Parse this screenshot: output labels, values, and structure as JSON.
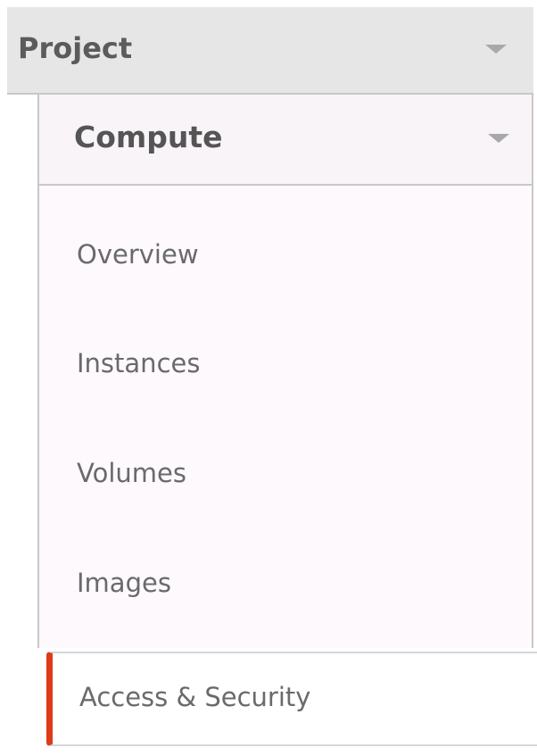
{
  "sidebar": {
    "project": {
      "label": "Project",
      "icon": "chevron-down-icon"
    },
    "compute": {
      "label": "Compute",
      "icon": "chevron-down-icon"
    },
    "items": [
      {
        "label": "Overview"
      },
      {
        "label": "Instances"
      },
      {
        "label": "Volumes"
      },
      {
        "label": "Images"
      },
      {
        "label": "Access & Security",
        "active": true
      }
    ],
    "colors": {
      "active_accent": "#dd3b17",
      "header_bg": "#e6e6e6",
      "text": "#6a6a6a"
    }
  }
}
